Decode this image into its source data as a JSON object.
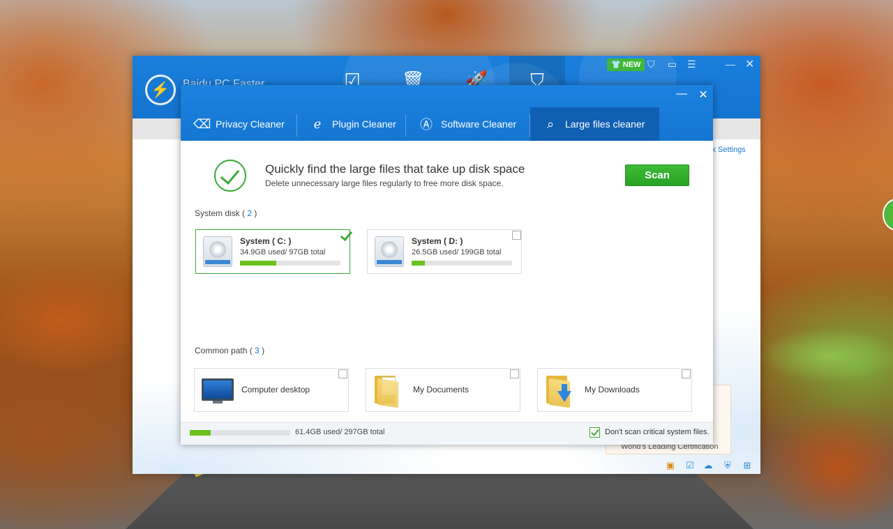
{
  "background": {
    "main_window": {
      "title": "Baidu PC Faster",
      "new_badge": "NEW",
      "quick_settings": "ck Settings",
      "certification": "World's Leading Certification"
    }
  },
  "dialog": {
    "tabs": [
      {
        "label": "Privacy Cleaner",
        "icon": "eraser-icon"
      },
      {
        "label": "Plugin Cleaner",
        "icon": "ie-icon"
      },
      {
        "label": "Software Cleaner",
        "icon": "app-store-icon"
      },
      {
        "label": "Large files cleaner",
        "icon": "file-search-icon",
        "active": true
      }
    ],
    "hero": {
      "title": "Quickly find the large files that take up disk space",
      "subtitle": "Delete unnecessary large files regularly to free more disk space."
    },
    "scan_label": "Scan",
    "system_disk": {
      "label": "System disk ( ",
      "count": "2",
      "close": " )",
      "disks": [
        {
          "name": "System ( C: )",
          "usage": "34.9GB  used/ 97GB  total",
          "fraction": 0.36,
          "checked": true
        },
        {
          "name": "System ( D: )",
          "usage": "26.5GB  used/ 199GB  total",
          "fraction": 0.13,
          "checked": false
        }
      ]
    },
    "common_path": {
      "label": "Common path ( ",
      "count": "3",
      "close": " )",
      "paths": [
        {
          "label": "Computer desktop",
          "icon": "monitor-icon",
          "checked": false
        },
        {
          "label": "My Documents",
          "icon": "documents-folder-icon",
          "checked": false
        },
        {
          "label": "My Downloads",
          "icon": "downloads-folder-icon",
          "checked": false
        }
      ]
    },
    "footer": {
      "usage": "61.4GB  used/ 297GB  total",
      "fraction": 0.21,
      "dont_scan_label": "Don't scan critical system files.",
      "dont_scan_checked": true
    }
  },
  "colors": {
    "accent_blue": "#1576d2",
    "green": "#3aaa35",
    "progress_green": "#6bc21f"
  }
}
